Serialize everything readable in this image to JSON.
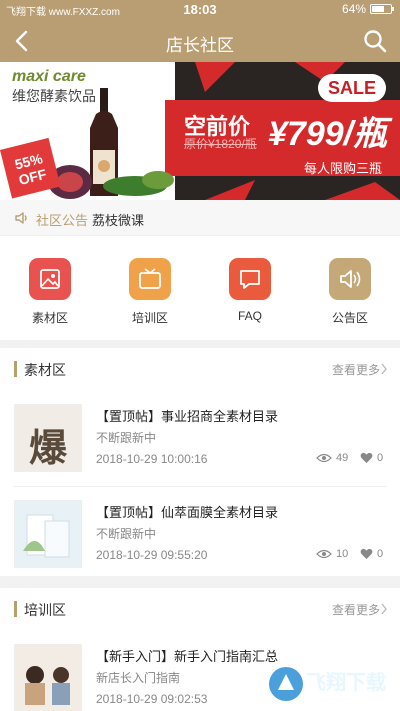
{
  "status_bar": {
    "watermark_site": "飞翔下载 www.FXXZ.com",
    "time": "18:03",
    "battery_percent": "64%",
    "battery_level": 0.64
  },
  "nav": {
    "title": "店长社区",
    "back_icon": "chevron-left-icon",
    "search_icon": "search-icon"
  },
  "banner": {
    "brand": "maxi care",
    "brand_sub": "维您酵素饮品",
    "sale": "SALE",
    "promo_title": "空前价",
    "old_price": "原价¥1820/瓶",
    "price": "¥799/瓶",
    "limit": "每人限购三瓶",
    "off_badge": "55% OFF"
  },
  "announcement": {
    "label": "社区公告",
    "text": "荔枝微课"
  },
  "grid": [
    {
      "label": "素材区",
      "color": "#e9534f",
      "icon": "image-icon"
    },
    {
      "label": "培训区",
      "color": "#f0a24a",
      "icon": "tv-icon"
    },
    {
      "label": "FAQ",
      "color": "#ea5a3c",
      "icon": "chat-icon"
    },
    {
      "label": "公告区",
      "color": "#c5a878",
      "icon": "speaker-icon"
    }
  ],
  "sections": {
    "materials": {
      "title": "素材区",
      "more": "查看更多",
      "posts": [
        {
          "title": "【置顶帖】事业招商全素材目录",
          "subtitle": "不断跟新中",
          "date": "2018-10-29 10:00:16",
          "views": "49",
          "likes": "0",
          "thumb_text": "爆"
        },
        {
          "title": "【置顶帖】仙萃面膜全素材目录",
          "subtitle": "不断跟新中",
          "date": "2018-10-29 09:55:20",
          "views": "10",
          "likes": "0"
        }
      ]
    },
    "training": {
      "title": "培训区",
      "more": "查看更多",
      "posts": [
        {
          "title": "【新手入门】新手入门指南汇总",
          "subtitle": "新店长入门指南",
          "date": "2018-10-29 09:02:53"
        }
      ]
    }
  },
  "watermark": {
    "main": "飞翔下载",
    "url": "www.FXXZ.com"
  },
  "colors": {
    "accent": "#b89e72",
    "promo_red": "#d42a2c",
    "banner_dark": "#2a2523"
  }
}
